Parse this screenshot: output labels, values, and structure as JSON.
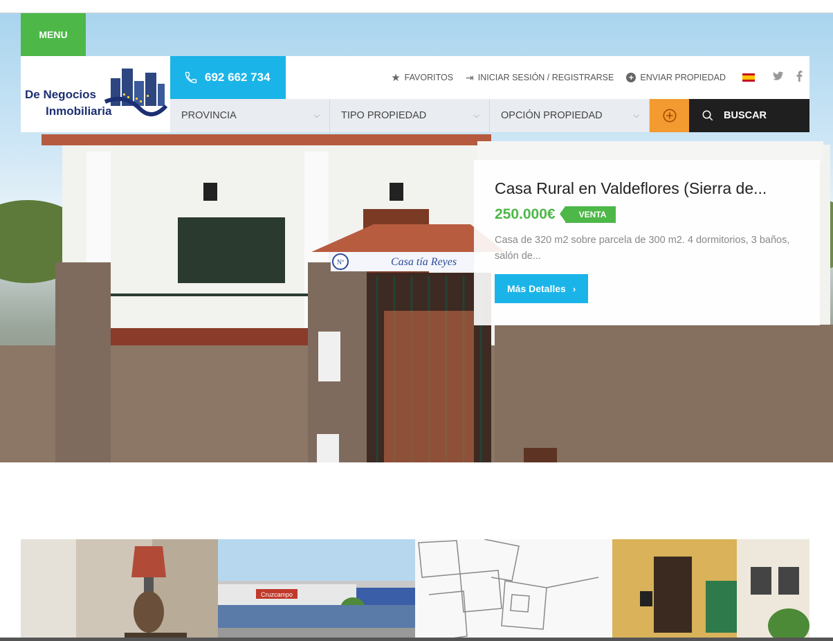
{
  "menu": {
    "label": "MENU"
  },
  "logo": {
    "line1": "De Negocios",
    "line2": "Inmobiliaria"
  },
  "phone": {
    "number": "692 662 734"
  },
  "top_links": {
    "favorites": "FAVORITOS",
    "login": "INICIAR SESIÓN / REGISTRARSE",
    "submit": "ENVIAR PROPIEDAD"
  },
  "search": {
    "province": "PROVINCIA",
    "type": "TIPO PROPIEDAD",
    "option": "OPCIÓN PROPIEDAD",
    "button": "BUSCAR"
  },
  "featured": {
    "title": "Casa Rural en Valdeflores (Sierra de...",
    "price": "250.000€",
    "status": "VENTA",
    "description": "Casa de 320 m2 sobre parcela de 300 m2. 4 dormitorios, 3 baños, salón de...",
    "button": "Más Detalles"
  },
  "hero_sign": {
    "text": "Casa tía Reyes",
    "number_mark": "Nº"
  },
  "thumb_sign": {
    "text": "Cruzcampo"
  },
  "colors": {
    "green": "#4db848",
    "blue": "#1bb4e8",
    "orange": "#f39a31",
    "dark": "#1f1f1f"
  }
}
